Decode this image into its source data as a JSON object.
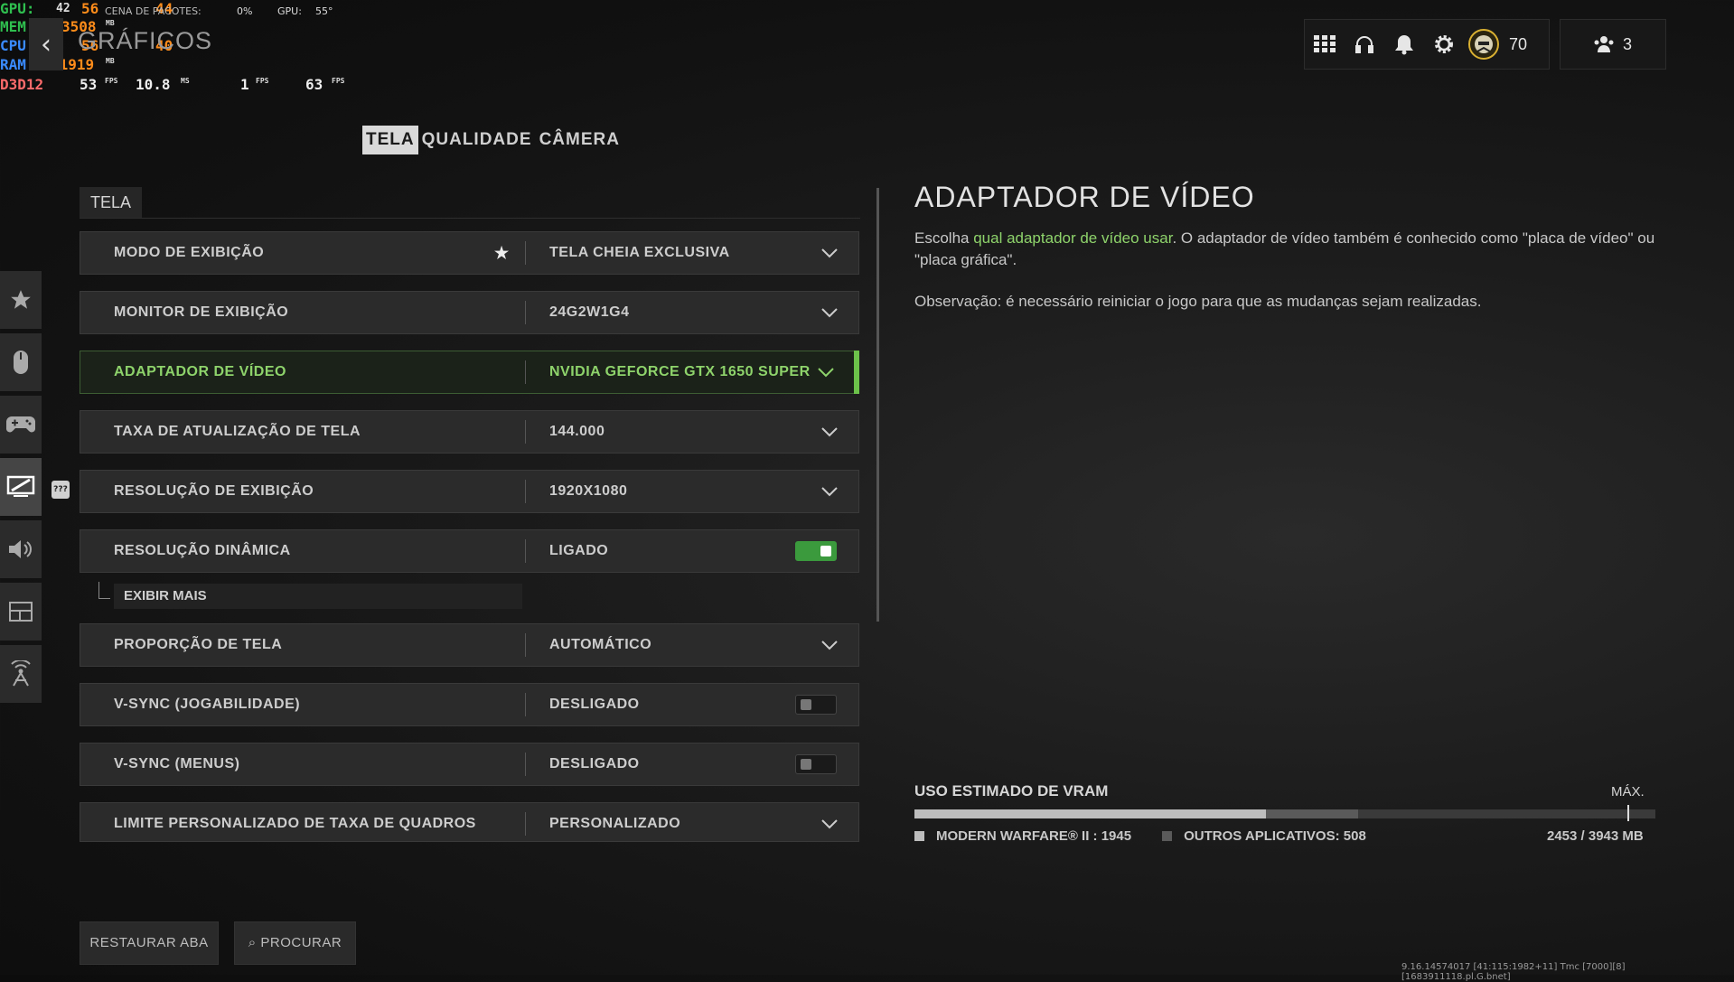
{
  "overlay": {
    "gpu_label": "GPU:",
    "gpu_v1": "42",
    "gpu_v2": "56",
    "gpu_v3": "44",
    "bg_text_1": "CENA DE PACOTES:",
    "bg_pct": "0%",
    "bg_gpu_label": "GPU:",
    "bg_gpu_val": "55°",
    "mem_label": "MEM",
    "mem_val": "3508",
    "mem_unit": "MB",
    "cpu_label": "CPU",
    "cpu_v1": "56",
    "cpu_v2": "40",
    "ram_label": "RAM",
    "ram_val": "11919",
    "ram_unit": "MB",
    "api": "D3D12",
    "fps1": "53",
    "fps1_unit": "FPS",
    "ms": "10.8",
    "ms_unit": "MS",
    "fps2": "1",
    "fps2_unit": "FPS",
    "fps3": "63",
    "fps3_unit": "FPS"
  },
  "header": {
    "back_icon": "‹",
    "title": "GRÁFICOS",
    "level": "70",
    "party_count": "3"
  },
  "tabs": [
    {
      "label": "TELA",
      "active": true
    },
    {
      "label": "QUALIDADE",
      "active": false
    },
    {
      "label": "CÂMERA",
      "active": false
    }
  ],
  "rail": {
    "badge": "???"
  },
  "section": {
    "title": "TELA"
  },
  "settings": [
    {
      "label": "MODO DE EXIBIÇÃO",
      "value": "TELA CHEIA EXCLUSIVA",
      "control": "dropdown",
      "favorite": true
    },
    {
      "label": "MONITOR DE EXIBIÇÃO",
      "value": "24G2W1G4",
      "control": "dropdown"
    },
    {
      "label": "ADAPTADOR DE VÍDEO",
      "value": "NVIDIA GEFORCE GTX 1650 SUPER",
      "control": "dropdown",
      "highlighted": true
    },
    {
      "label": "TAXA DE ATUALIZAÇÃO DE TELA",
      "value": "144.000",
      "control": "dropdown"
    },
    {
      "label": "RESOLUÇÃO DE EXIBIÇÃO",
      "value": "1920X1080",
      "control": "dropdown"
    },
    {
      "label": "RESOLUÇÃO DINÂMICA",
      "value": "LIGADO",
      "control": "toggle",
      "on": true
    },
    {
      "label": "PROPORÇÃO DE TELA",
      "value": "AUTOMÁTICO",
      "control": "dropdown"
    },
    {
      "label": "V-SYNC (JOGABILIDADE)",
      "value": "DESLIGADO",
      "control": "toggle",
      "on": false
    },
    {
      "label": "V-SYNC (MENUS)",
      "value": "DESLIGADO",
      "control": "toggle",
      "on": false
    },
    {
      "label": "LIMITE PERSONALIZADO DE TAXA DE QUADROS",
      "value": "PERSONALIZADO",
      "control": "dropdown"
    }
  ],
  "show_more": "EXIBIR MAIS",
  "description": {
    "title": "ADAPTADOR DE VÍDEO",
    "lead": "Escolha ",
    "link": "qual adaptador de vídeo usar",
    "rest": ". O adaptador de vídeo também é conhecido como \"placa de vídeo\" ou \"placa gráfica\".",
    "note": "Observação: é necessário reiniciar o jogo para que as mudanças sejam realizadas."
  },
  "vram": {
    "title": "USO ESTIMADO DE VRAM",
    "max_label": "MÁX.",
    "mw_label": "MODERN WARFARE® II : 1945",
    "other_label": "OUTROS APLICATIVOS: 508",
    "total": "2453 / 3943 MB",
    "mw_mb": 1945,
    "other_mb": 508,
    "capacity_mb": 4100,
    "max_mb": 3943,
    "mw_color": "#bdbdbd",
    "other_color": "#5a5a5a"
  },
  "buttons": {
    "restore": "RESTAURAR ABA",
    "search": "PROCURAR"
  },
  "build": "9.16.14574017 [41:115:1982+11] Tmc [7000][8][1683911118.pl.G.bnet]",
  "colors": {
    "accent_green": "#6cc24a",
    "text_green": "#8ed36b"
  }
}
